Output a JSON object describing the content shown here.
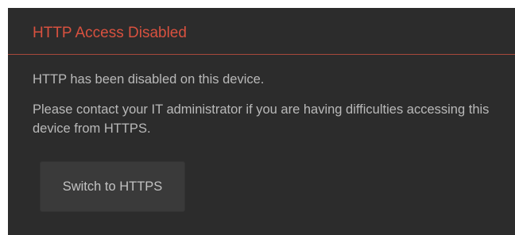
{
  "panel": {
    "title": "HTTP Access Disabled",
    "message_line": "HTTP has been disabled on this device.",
    "message_contact": "Please contact your IT administrator if you are having difficulties accessing this device from HTTPS.",
    "switch_button_label": "Switch to HTTPS"
  },
  "colors": {
    "panel_background": "#2c2c2c",
    "title_color": "#d8513f",
    "divider_color": "#a8483c",
    "text_color": "#b9b9b9",
    "button_background": "#3a3a3a"
  }
}
